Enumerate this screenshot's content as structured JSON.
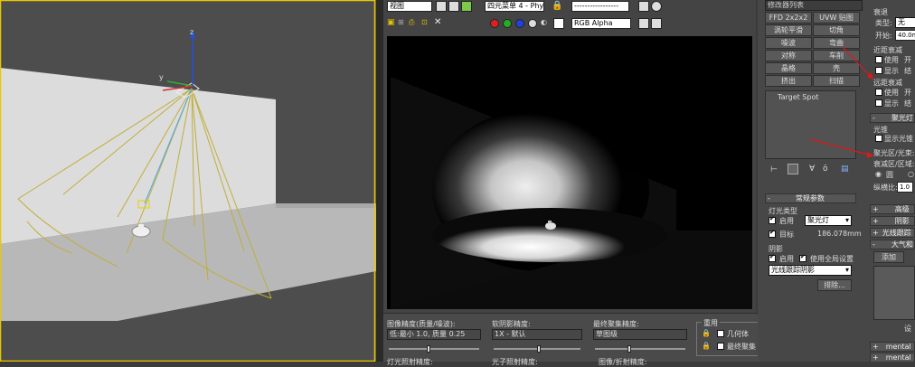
{
  "viewport": {},
  "render_toolbar": {
    "view_select": "视图",
    "menu_select": "四元菜单 4 - Phy",
    "blank_select": "-----------------",
    "channel_select": "RGB Alpha"
  },
  "render_bottom": {
    "image_precision_label": "图像精度(质量/噪波):",
    "image_precision_value": "低:最小 1.0, 质量 0.25",
    "soft_shadow_label": "软阴影精度:",
    "soft_shadow_value": "1X - 默认",
    "final_gather_label": "最终聚集精度:",
    "final_gather_value": "草图级",
    "reuse_label": "重用",
    "geometry_label": "几何体",
    "final_gather_chk_label": "最终聚集",
    "bottom_cut_1": "灯光照射精度:",
    "bottom_cut_2": "光子照射精度:",
    "bottom_cut_3": "图像/折射精度:"
  },
  "modifier": {
    "list_select": "修改器列表",
    "buttons": [
      [
        "FFD 2x2x2",
        "UVW 贴图"
      ],
      [
        "涡轮平滑",
        "切角"
      ],
      [
        "噪波",
        "弯曲"
      ],
      [
        "对称",
        "车削"
      ],
      [
        "晶格",
        "壳"
      ],
      [
        "挤出",
        "扫描"
      ]
    ],
    "stack_item": "Target Spot",
    "general_header": "常规参数",
    "light_type_label": "灯光类型",
    "enable_label": "启用",
    "light_type_value": "聚光灯",
    "target_label": "目标",
    "target_distance": "186.078mm",
    "shadow_label": "阴影",
    "shadow_enable_label": "启用",
    "global_settings_label": "使用全局设置",
    "shadow_type_value": "光线跟踪阴影",
    "exclude_button": "排除..."
  },
  "right": {
    "decay_header": "衰退",
    "type_label": "类型:",
    "type_value": "无",
    "start_label": "开始:",
    "start_value": "40.0m",
    "near_atten_label": "近距衰减",
    "use_label_1": "使用",
    "start_label_2": "开",
    "show_label_1": "显示",
    "end_label_1": "结",
    "far_atten_label": "远距衰减",
    "use_label_2": "使用",
    "start_label_3": "开",
    "show_label_2": "显示",
    "end_label_2": "结",
    "spot_header": "聚光灯",
    "cone_label": "光锥",
    "show_cone_label": "显示光锥",
    "hotspot_label": "聚光区/光束:",
    "falloff_label": "衰减区/区域:",
    "circle_label": "圆",
    "aspect_label": "纵横比:",
    "aspect_value": "1.0",
    "advanced_label": "高级",
    "shadow_params_label": "阴影",
    "raytrace_shadow_label": "光线跟踪",
    "atmos_header": "大气和",
    "add_button": "添加",
    "settings_label": "设",
    "mr_label_1": "mental ray",
    "mr_label_2": "mental ray"
  }
}
